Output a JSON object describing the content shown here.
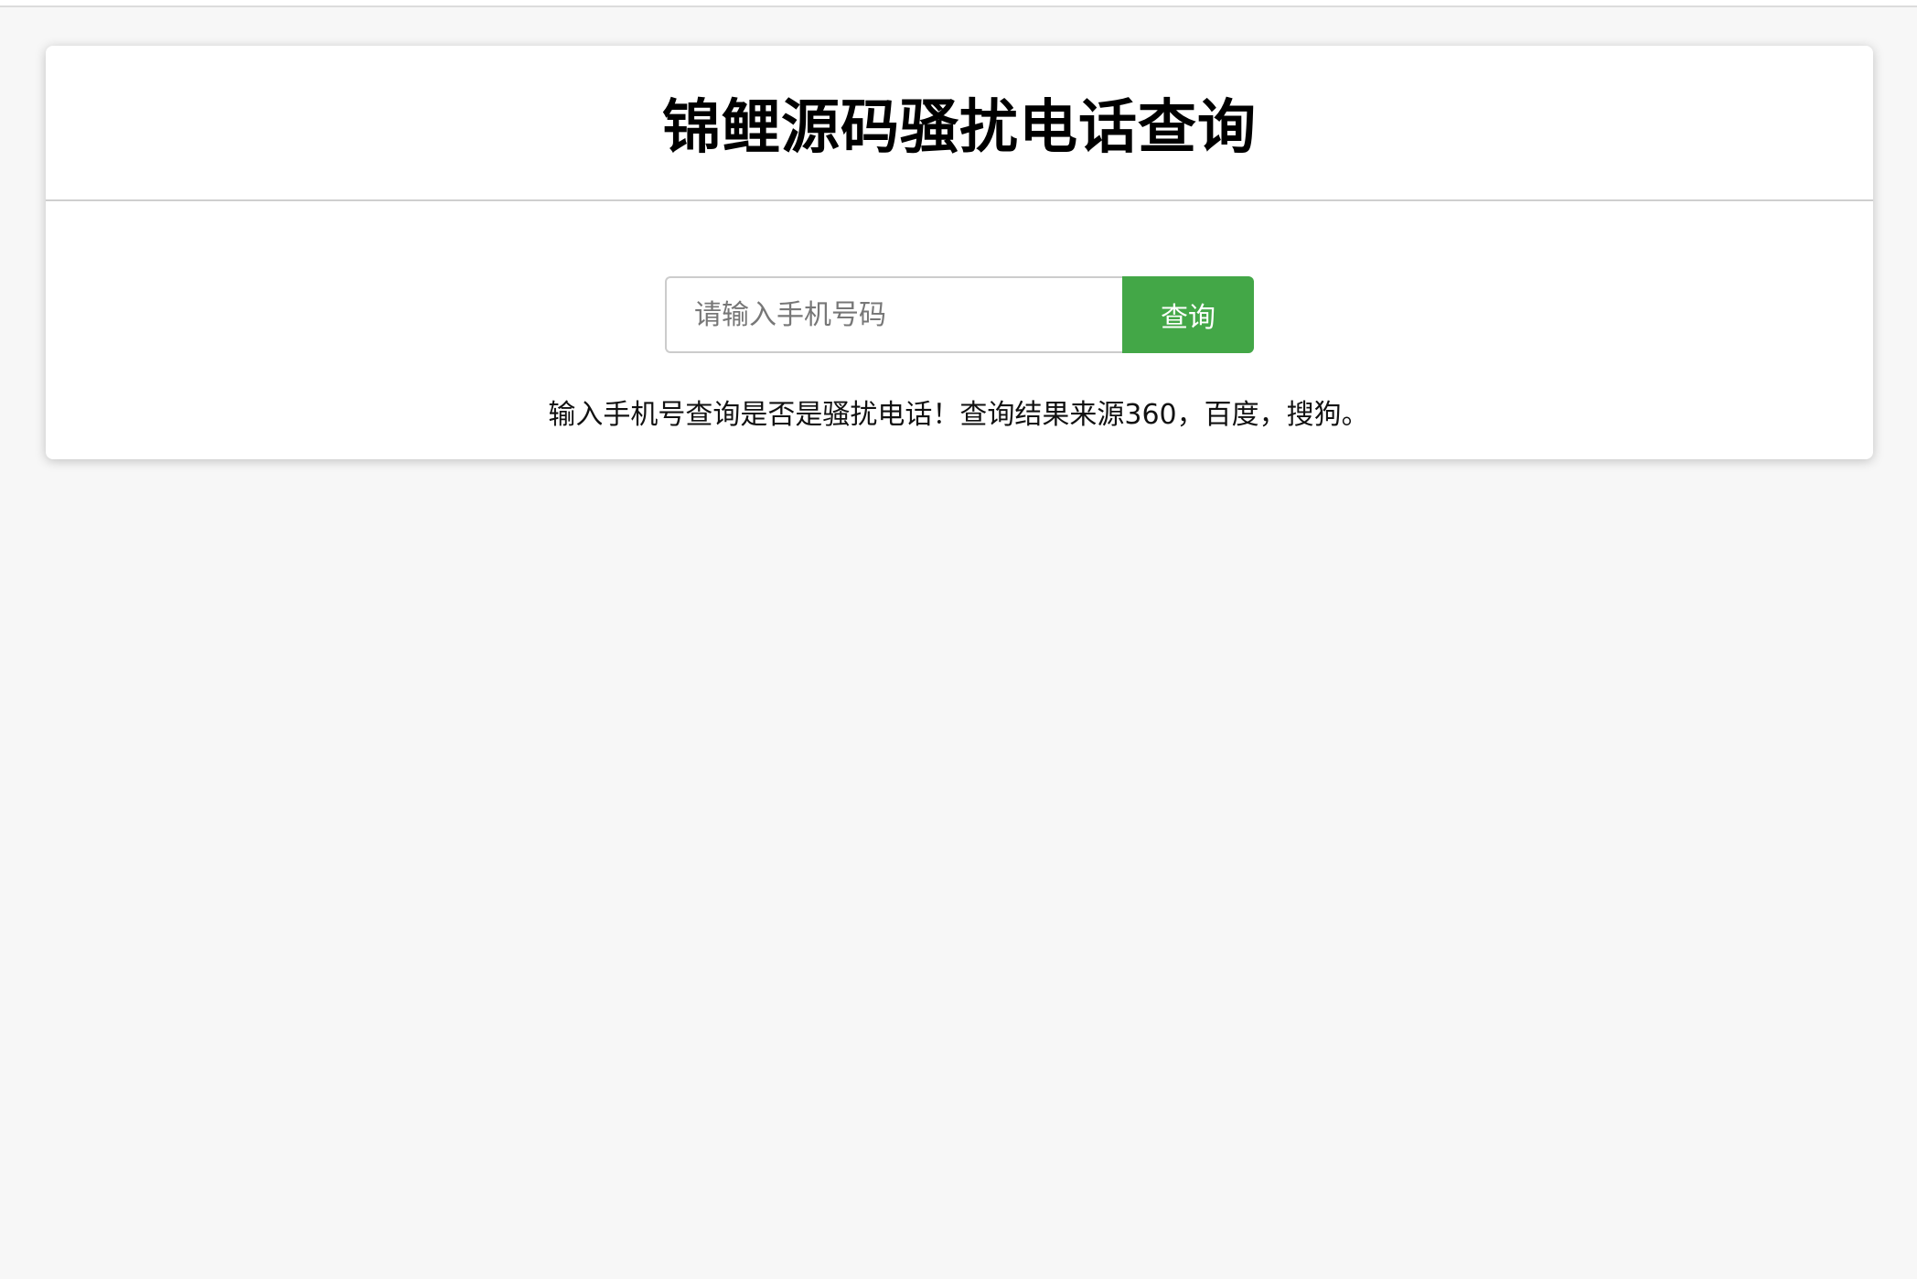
{
  "page": {
    "title": "锦鲤源码骚扰电话查询",
    "background_color": "#f7f7f7"
  },
  "search": {
    "placeholder": "请输入手机号码",
    "value": "",
    "button_label": "查询",
    "button_color": "#43a747"
  },
  "hint": {
    "text": "输入手机号查询是否是骚扰电话！查询结果来源360，百度，搜狗。"
  }
}
